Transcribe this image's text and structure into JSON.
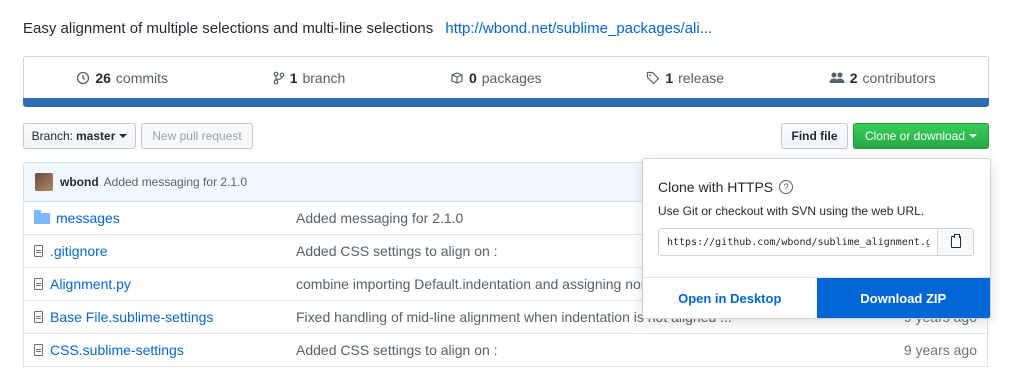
{
  "repo": {
    "description": "Easy alignment of multiple selections and multi-line selections",
    "homepage": "http://wbond.net/sublime_packages/ali..."
  },
  "summary": {
    "commits_count": "26",
    "commits_label": "commits",
    "branches_count": "1",
    "branches_label": "branch",
    "packages_count": "0",
    "packages_label": "packages",
    "releases_count": "1",
    "releases_label": "release",
    "contributors_count": "2",
    "contributors_label": "contributors",
    "language_color": "#2b6cb3"
  },
  "toolbar": {
    "branch_label": "Branch:",
    "branch_value": "master",
    "new_pr": "New pull request",
    "find_file": "Find file",
    "clone_download": "Clone or download"
  },
  "latest_commit": {
    "author": "wbond",
    "message": "Added messaging for 2.1.0"
  },
  "files": [
    {
      "name": "messages",
      "type": "folder",
      "message": "Added messaging for 2.1.0",
      "age": ""
    },
    {
      "name": ".gitignore",
      "type": "file",
      "message": "Added CSS settings to align on :",
      "age": ""
    },
    {
      "name": "Alignment.py",
      "type": "file",
      "message": "combine importing Default.indentation and assigning nor",
      "age": ""
    },
    {
      "name": "Base File.sublime-settings",
      "type": "file",
      "message": "Fixed handling of mid-line alignment when indentation is not aligned ...",
      "age": "9 years ago"
    },
    {
      "name": "CSS.sublime-settings",
      "type": "file",
      "message": "Added CSS settings to align on :",
      "age": "9 years ago"
    }
  ],
  "clone_popup": {
    "title": "Clone with HTTPS",
    "help_icon": "question-icon",
    "subtitle": "Use Git or checkout with SVN using the web URL.",
    "url": "https://github.com/wbond/sublime_alignment.git",
    "open_desktop": "Open in Desktop",
    "download_zip": "Download ZIP"
  }
}
